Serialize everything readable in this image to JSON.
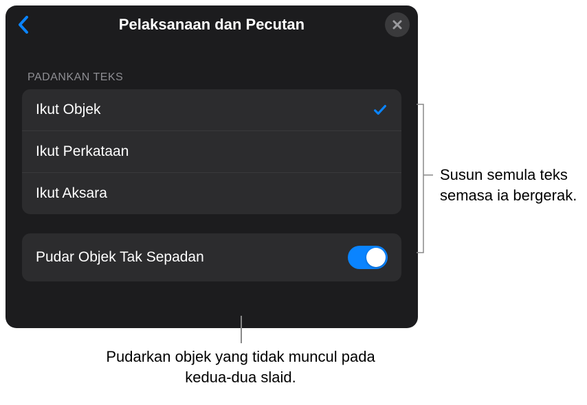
{
  "header": {
    "title": "Pelaksanaan dan Pecutan"
  },
  "section": {
    "header": "PADANKAN TEKS",
    "options": [
      {
        "label": "Ikut Objek",
        "selected": true
      },
      {
        "label": "Ikut Perkataan",
        "selected": false
      },
      {
        "label": "Ikut Aksara",
        "selected": false
      }
    ]
  },
  "toggle": {
    "label": "Pudar Objek Tak Sepadan",
    "on": true
  },
  "callouts": {
    "right": "Susun semula teks semasa ia bergerak.",
    "bottom": "Pudarkan objek yang tidak muncul pada kedua-dua slaid."
  },
  "colors": {
    "accent": "#0a84ff",
    "panel_bg": "#1c1c1e",
    "group_bg": "#2c2c2e"
  }
}
